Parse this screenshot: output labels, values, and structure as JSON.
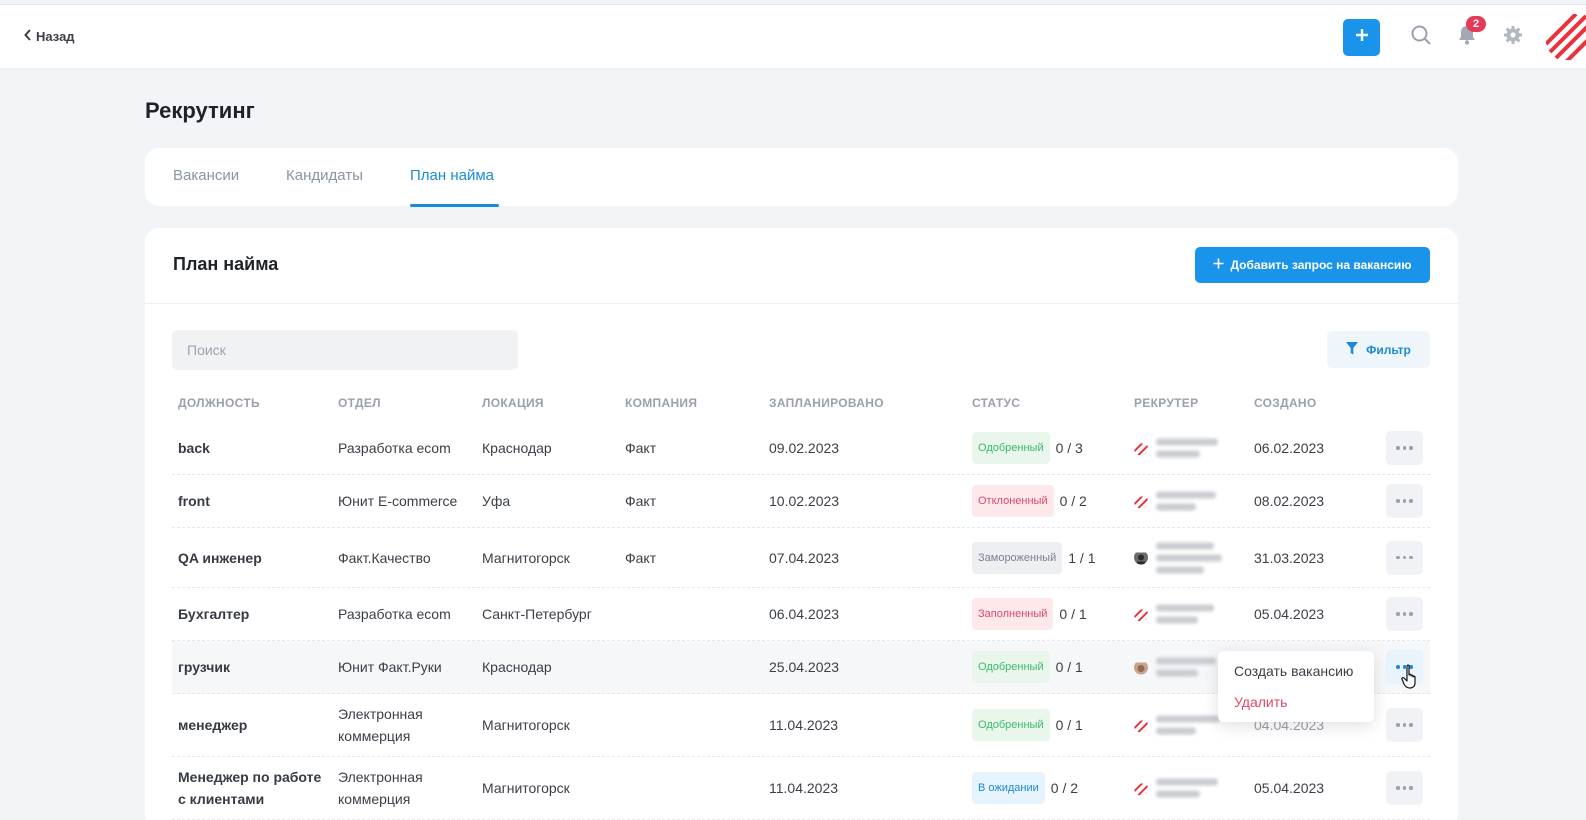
{
  "topbar": {
    "back_label": "Назад",
    "notification_count": "2",
    "icons": [
      "chevron-left-icon",
      "plus-icon",
      "search-icon",
      "bell-icon",
      "gear-icon",
      "company-logo"
    ]
  },
  "page": {
    "title": "Рекрутинг"
  },
  "tabs": [
    {
      "label": "Вакансии",
      "active": false
    },
    {
      "label": "Кандидаты",
      "active": false
    },
    {
      "label": "План найма",
      "active": true
    }
  ],
  "card": {
    "title": "План найма",
    "add_button_label": "Добавить запрос на вакансию",
    "search_placeholder": "Поиск",
    "filter_label": "Фильтр"
  },
  "table": {
    "columns": [
      "ДОЛЖНОСТЬ",
      "ОТДЕЛ",
      "ЛОКАЦИЯ",
      "КОМПАНИЯ",
      "ЗАПЛАНИРОВАНО",
      "СТАТУС",
      "РЕКРУТЕР",
      "СОЗДАНО"
    ],
    "rows": [
      {
        "position": "back",
        "department": "Разработка ecom",
        "location": "Краснодар",
        "company": "Факт",
        "planned": "09.02.2023",
        "status": "Одобренный",
        "status_color": "#3dba6b",
        "count": "0 / 3",
        "created": "06.02.2023"
      },
      {
        "position": "front",
        "department": "Юнит E-commerce",
        "location": "Уфа",
        "company": "Факт",
        "planned": "10.02.2023",
        "status": "Отклоненный",
        "status_color": "#e0476a",
        "count": "0 / 2",
        "created": "08.02.2023"
      },
      {
        "position": "QA инженер",
        "department": "Факт.Качество",
        "location": "Магнитогорск",
        "company": "Факт",
        "planned": "07.04.2023",
        "status": "Замороженный",
        "status_color": "#7b8190",
        "count": "1 / 1",
        "created": "31.03.2023"
      },
      {
        "position": "Бухгалтер",
        "department": "Разработка ecom",
        "location": "Санкт-Петербург",
        "company": "",
        "planned": "06.04.2023",
        "status": "Заполненный",
        "status_color": "#e0476a",
        "count": "0 / 1",
        "created": "05.04.2023"
      },
      {
        "position": "грузчик",
        "department": "Юнит Факт.Руки",
        "location": "Краснодар",
        "company": "",
        "planned": "25.04.2023",
        "status": "Одобренный",
        "status_color": "#3dba6b",
        "count": "0 / 1",
        "created": ""
      },
      {
        "position": "менеджер",
        "department": "Электронная коммерция",
        "location": "Магнитогорск",
        "company": "",
        "planned": "11.04.2023",
        "status": "Одобренный",
        "status_color": "#3dba6b",
        "count": "0 / 1",
        "created": "04.04.2023"
      },
      {
        "position": "Менеджер по работе с клиентами",
        "department": "Электронная коммерция",
        "location": "Магнитогорск",
        "company": "",
        "planned": "11.04.2023",
        "status": "В ожидании",
        "status_color": "#1a8bd8",
        "count": "0 / 2",
        "created": "05.04.2023"
      }
    ]
  },
  "context_menu": {
    "items": [
      {
        "label": "Создать вакансию",
        "color": "#3a3f47"
      },
      {
        "label": "Удалить",
        "color": "#e0476a"
      }
    ]
  },
  "colors": {
    "accent": "#1a94ea",
    "badge": "#e63958",
    "logo": "#e8323c"
  }
}
